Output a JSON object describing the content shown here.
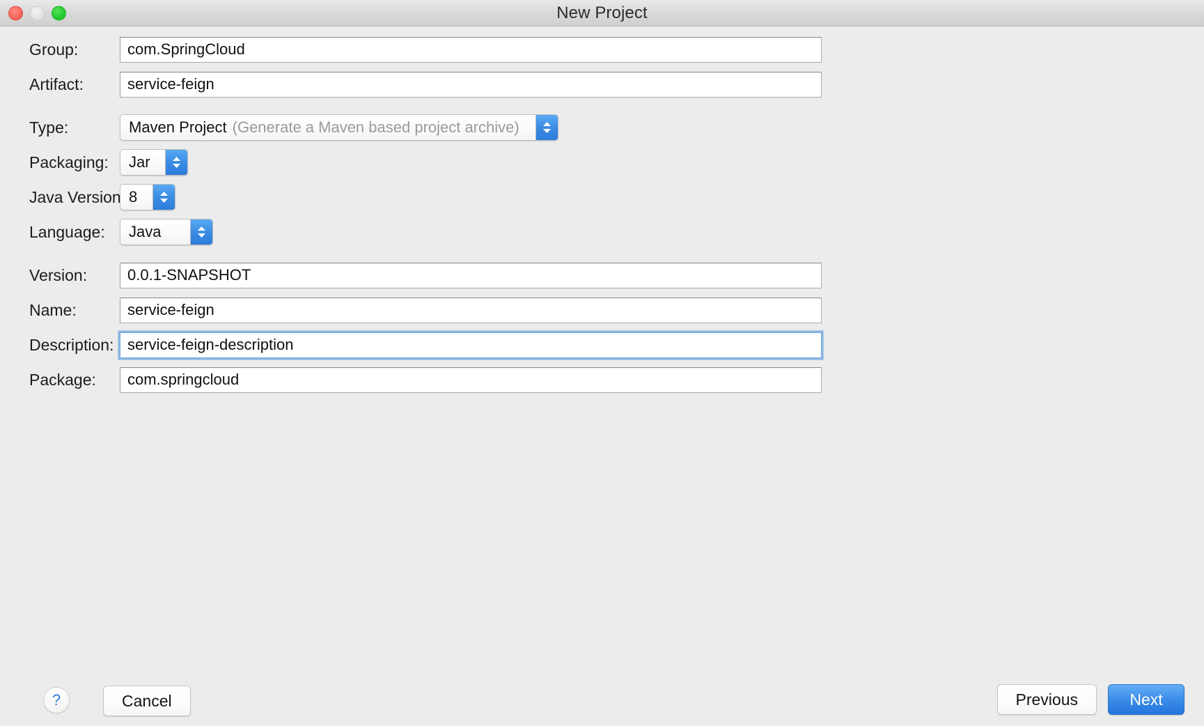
{
  "window": {
    "title": "New Project",
    "traffic_lights": [
      "close-button",
      "minimize-button",
      "maximize-button"
    ]
  },
  "form": {
    "fields": [
      {
        "label": "Group:",
        "value": "com.SpringCloud",
        "kind": "text",
        "focused": false
      },
      {
        "label": "Artifact:",
        "value": "service-feign",
        "kind": "text",
        "focused": false
      },
      {
        "label": "Type:",
        "value": "Maven Project",
        "hint": "(Generate a Maven based project archive)",
        "kind": "popup"
      },
      {
        "label": "Packaging:",
        "value": "Jar",
        "kind": "popup"
      },
      {
        "label": "Java Version:",
        "value": "8",
        "kind": "popup"
      },
      {
        "label": "Language:",
        "value": "Java",
        "kind": "popup"
      },
      {
        "label": "Version:",
        "value": "0.0.1-SNAPSHOT",
        "kind": "text",
        "focused": false
      },
      {
        "label": "Name:",
        "value": "service-feign",
        "kind": "text",
        "focused": false
      },
      {
        "label": "Description:",
        "value": "service-feign-description",
        "kind": "text",
        "focused": true
      },
      {
        "label": "Package:",
        "value": "com.springcloud",
        "kind": "text",
        "focused": false
      }
    ]
  },
  "footer": {
    "help_label": "?",
    "cancel_label": "Cancel",
    "previous_label": "Previous",
    "next_label": "Next"
  },
  "colors": {
    "window_background": "#ececec",
    "accent_blue": "#3c8ee8",
    "focus_ring": "#73a8e1",
    "hint_gray": "#9a9a9a",
    "close_red": "#fb6a62",
    "minimize_gray": "#e6e6e6",
    "maximize_green": "#26cc33"
  }
}
